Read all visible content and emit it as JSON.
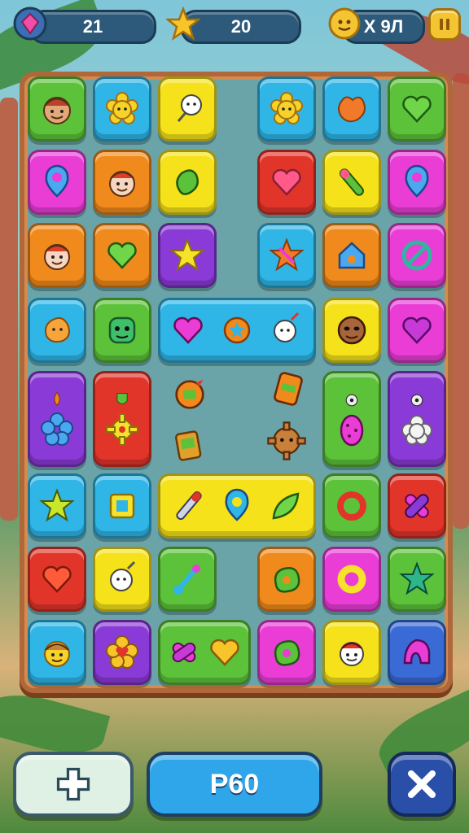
{
  "hud": {
    "gems": "21",
    "stars": "20",
    "coins": "X 9Л",
    "pause_icon": "pause-icon"
  },
  "board": {
    "tiles": [
      {
        "color": "green",
        "icon": "face-icon"
      },
      {
        "color": "blue",
        "icon": "flower-icon"
      },
      {
        "color": "yellow",
        "icon": "lollipop-icon"
      },
      {
        "color": "blue",
        "icon": "flower-icon"
      },
      {
        "color": "blue",
        "icon": "blob-icon"
      },
      {
        "color": "green",
        "icon": "heart-icon"
      }
    ],
    "combo_row_4": [
      "heart-icon",
      "star-flower-icon",
      "lollipop-icon"
    ],
    "combo_row_6": [
      "brush-icon",
      "ring-icon",
      "leaf-icon"
    ],
    "combo_row_8": [
      "candy-icon",
      "heart-icon"
    ]
  },
  "buttons": {
    "add_icon": "plus-icon",
    "main_label": "P60",
    "close_icon": "close-icon"
  },
  "colors": {
    "green": "#5cc23a",
    "blue": "#2fb5e6",
    "yellow": "#f5e21a",
    "pink": "#e93dd6",
    "orange": "#f08a1c",
    "red": "#e2352a",
    "purple": "#8a3ad6",
    "board_frame": "#b0673a"
  }
}
